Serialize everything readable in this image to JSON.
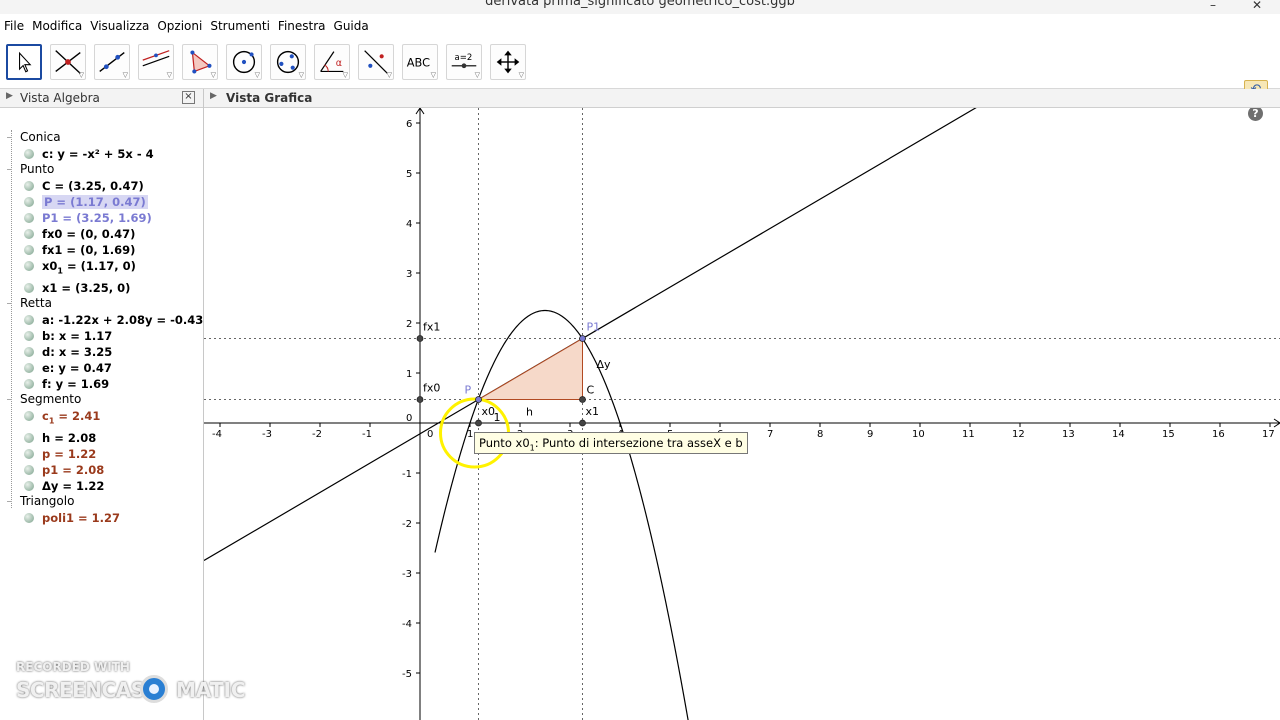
{
  "window": {
    "title": "derivata prima_significato geometrico_cost.ggb"
  },
  "menu": [
    "File",
    "Modifica",
    "Visualizza",
    "Opzioni",
    "Strumenti",
    "Finestra",
    "Guida"
  ],
  "toolbar": {
    "tools": [
      "move-tool",
      "point-tool",
      "line-tool",
      "perpendicular-tool",
      "polygon-tool",
      "circle-tool",
      "conic-tool",
      "angle-tool",
      "reflect-tool",
      "text-tool",
      "slider-tool",
      "move-view-tool"
    ],
    "text_tool_label": "ABC",
    "slider_tool_label": "a=2",
    "selected": "move-tool"
  },
  "algebra": {
    "title": "Vista Algebra",
    "close": "×",
    "groups": [
      {
        "name": "Conica",
        "items": [
          {
            "text": "c: y = -x² + 5x - 4"
          }
        ]
      },
      {
        "name": "Punto",
        "items": [
          {
            "text": "C = (3.25, 0.47)"
          },
          {
            "text": "P = (1.17, 0.47)",
            "highlight": true
          },
          {
            "text": "P1 = (3.25, 1.69)",
            "color": "#7a7ad2"
          },
          {
            "text": "fx0 = (0, 0.47)"
          },
          {
            "text": "fx1 = (0, 1.69)"
          },
          {
            "text": "x0",
            "sub": "1",
            "rest": " = (1.17, 0)"
          },
          {
            "text": "x1 = (3.25, 0)"
          }
        ]
      },
      {
        "name": "Retta",
        "items": [
          {
            "text": "a: -1.22x + 2.08y = -0.43"
          },
          {
            "text": "b: x = 1.17"
          },
          {
            "text": "d: x = 3.25"
          },
          {
            "text": "e: y = 0.47"
          },
          {
            "text": "f: y = 1.69"
          }
        ]
      },
      {
        "name": "Segmento",
        "items": [
          {
            "text": "c",
            "sub": "1",
            "rest": " = 2.41",
            "color": "#9a3a1c"
          },
          {
            "text": "h = 2.08"
          },
          {
            "text": "p = 1.22",
            "color": "#9a3a1c"
          },
          {
            "text": "p1 = 2.08",
            "color": "#9a3a1c"
          },
          {
            "text": "Δy = 1.22"
          }
        ]
      },
      {
        "name": "Triangolo",
        "items": [
          {
            "text": "poli1 = 1.27",
            "color": "#9a3a1c"
          }
        ]
      }
    ]
  },
  "graphics": {
    "title": "Vista Grafica",
    "x_ticks": [
      "-4",
      "-3",
      "-2",
      "-1",
      "0",
      "1",
      "2",
      "3",
      "4",
      "5",
      "6",
      "7",
      "8",
      "9",
      "10",
      "11",
      "12",
      "13",
      "14",
      "15",
      "16",
      "17"
    ],
    "y_ticks": [
      "6",
      "5",
      "4",
      "3",
      "2",
      "1",
      "0",
      "-1",
      "-2",
      "-3",
      "-4",
      "-5"
    ],
    "labels": {
      "P": "P",
      "P1": "P1",
      "C": "C",
      "fx0": "fx0",
      "fx1": "fx1",
      "x0": "x0",
      "x0_sub": "1",
      "x1": "x1",
      "h": "h",
      "dy": "Δy"
    }
  },
  "tooltip": {
    "prefix": "Punto x0",
    "sub": "1",
    "suffix": ": Punto di intersezione tra asseX e b"
  },
  "watermark": {
    "line1": "RECORDED WITH",
    "line2a": "SCREENCAST",
    "line2b": "MATIC"
  },
  "colors": {
    "triangle_fill": "#f6d9c9",
    "triangle_stroke": "#b24a22",
    "point_blue": "#7a7ad2",
    "highlight": "#fff200"
  }
}
